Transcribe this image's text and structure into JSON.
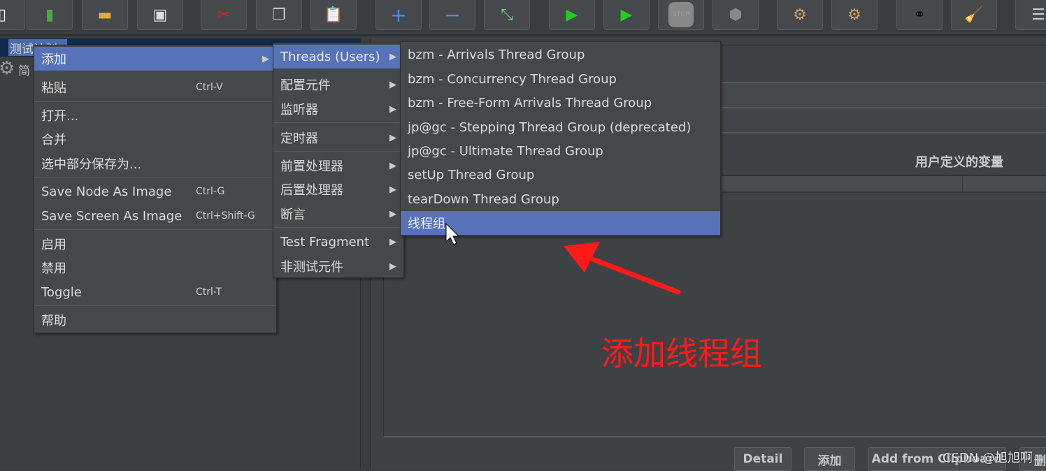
{
  "toolbar": {
    "icons": [
      "new-icon",
      "templates-icon",
      "open-icon",
      "save-icon",
      "cut-icon",
      "copy-icon",
      "paste-icon",
      "expand-icon",
      "collapse-icon",
      "toggle-icon",
      "start-icon",
      "start-no-pause-icon",
      "stop-icon",
      "shutdown-icon",
      "clear-icon",
      "clear-all-icon",
      "search-icon",
      "reset-search-icon",
      "function-helper-icon"
    ],
    "stop_label": "STOP"
  },
  "tree": {
    "test_plan": "测试计划",
    "child": "简"
  },
  "context_menu": {
    "items": [
      {
        "label": "添加",
        "shortcut": ""
      },
      {
        "label": "粘贴",
        "shortcut": "Ctrl-V"
      },
      {
        "label": "打开...",
        "shortcut": ""
      },
      {
        "label": "合并",
        "shortcut": ""
      },
      {
        "label": "选中部分保存为...",
        "shortcut": ""
      },
      {
        "label": "Save Node As Image",
        "shortcut": "Ctrl-G"
      },
      {
        "label": "Save Screen As Image",
        "shortcut": "Ctrl+Shift-G"
      },
      {
        "label": "启用",
        "shortcut": ""
      },
      {
        "label": "禁用",
        "shortcut": ""
      },
      {
        "label": "Toggle",
        "shortcut": "Ctrl-T"
      },
      {
        "label": "帮助",
        "shortcut": ""
      }
    ]
  },
  "add_menu": {
    "items": [
      {
        "label": "Threads (Users)"
      },
      {
        "label": "配置元件"
      },
      {
        "label": "监听器"
      },
      {
        "label": "定时器"
      },
      {
        "label": "前置处理器"
      },
      {
        "label": "后置处理器"
      },
      {
        "label": "断言"
      },
      {
        "label": "Test Fragment"
      },
      {
        "label": "非测试元件"
      }
    ]
  },
  "threads_menu": {
    "items": [
      {
        "label": "bzm - Arrivals Thread Group"
      },
      {
        "label": "bzm - Concurrency Thread Group"
      },
      {
        "label": "bzm - Free-Form Arrivals Thread Group"
      },
      {
        "label": "jp@gc - Stepping Thread Group (deprecated)"
      },
      {
        "label": "jp@gc - Ultimate Thread Group"
      },
      {
        "label": "setUp Thread Group"
      },
      {
        "label": "tearDown Thread Group"
      },
      {
        "label": "线程组"
      }
    ]
  },
  "right_panel": {
    "variables_title": "用户定义的变量",
    "buttons": {
      "detail": "Detail",
      "add": "添加",
      "add_clipboard": "Add from Clipboard",
      "delete": "删"
    }
  },
  "annotation": {
    "text": "添加线程组",
    "color": "#ff1a1a"
  },
  "watermark": "CSDN @旭旭啊",
  "colors": {
    "highlight": "#5673b8",
    "background": "#3c3f41"
  }
}
